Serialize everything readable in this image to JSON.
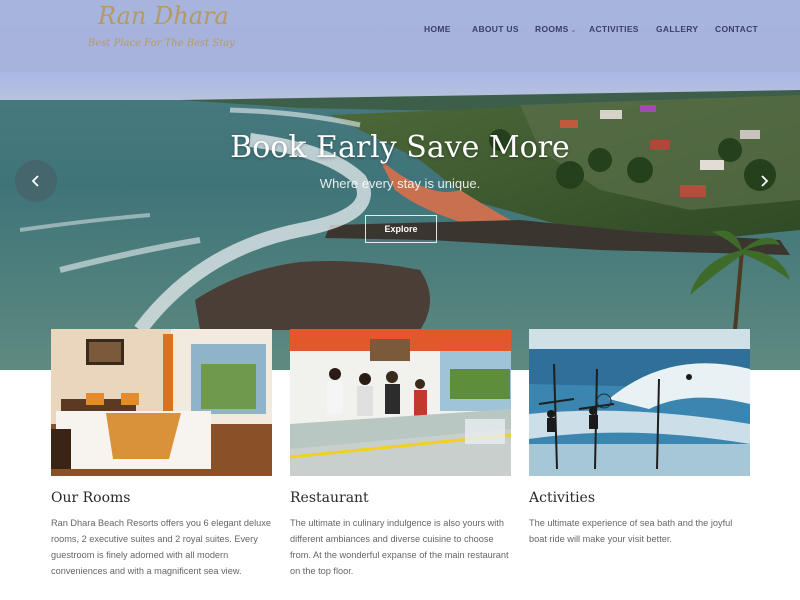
{
  "colors": {
    "header_bg": "#bcc0f0",
    "logo_gold": "#b59a63",
    "nav_text": "#3a3f66",
    "hero_text": "#ffffff",
    "card_title": "#2a2a2a",
    "card_text": "#666666"
  },
  "header": {
    "logo_title": "Ran Dhara",
    "logo_tagline": "Best Place For The Best Stay",
    "nav": [
      {
        "label": "HOME"
      },
      {
        "label": "ABOUT US"
      },
      {
        "label": "ROOMS",
        "has_dropdown": true
      },
      {
        "label": "ACTIVITIES"
      },
      {
        "label": "GALLERY"
      },
      {
        "label": "CONTACT"
      }
    ]
  },
  "hero": {
    "title": "Book Early Save More",
    "subtitle": "Where every stay is unique.",
    "button_label": "Explore",
    "prev_icon": "chevron-left-icon",
    "next_icon": "chevron-right-icon"
  },
  "cards": [
    {
      "title": "Our Rooms",
      "text": "Ran Dhara Beach Resorts offers you 6 elegant deluxe rooms, 2 executive suites and 2 royal suites. Every guestroom is finely adorned with all modern conveniences and with a magnificent sea view."
    },
    {
      "title": "Restaurant",
      "text": "The ultimate in culinary indulgence is also yours with different ambiances and diverse cuisine to choose from. At the wonderful expanse of the main restaurant on the top floor."
    },
    {
      "title": "Activities",
      "text": "The ultimate experience of sea bath and the joyful boat ride will make your visit better."
    }
  ]
}
